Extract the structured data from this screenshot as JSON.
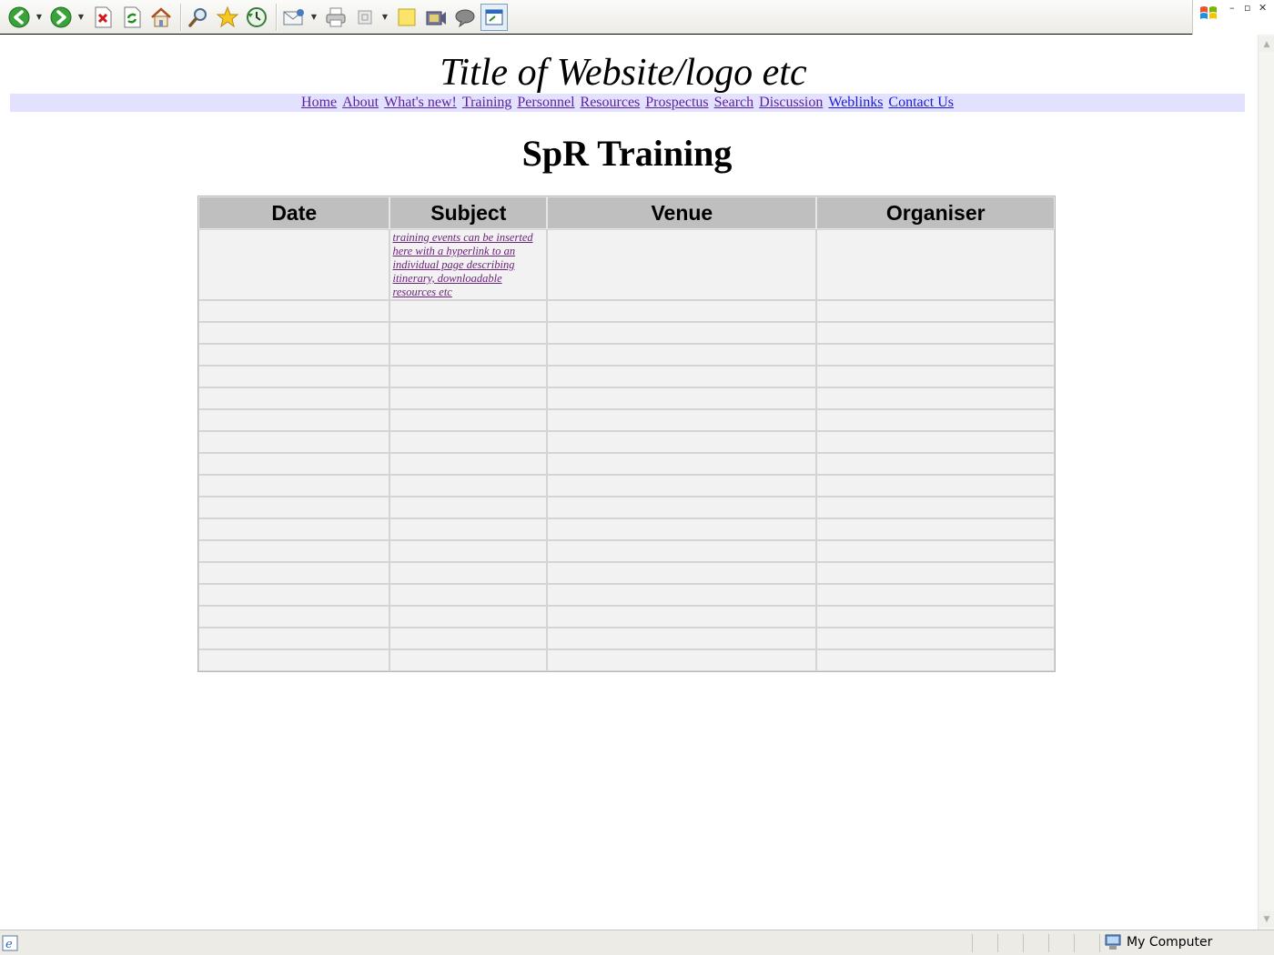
{
  "browser": {
    "toolbar_icons": [
      "back-icon",
      "forward-icon",
      "stop-icon",
      "refresh-icon",
      "home-icon",
      "search-icon",
      "favorites-icon",
      "history-icon",
      "mail-icon",
      "print-icon",
      "edit-icon",
      "notes-icon",
      "media-icon",
      "discuss-icon",
      "active-window-icon"
    ],
    "status_zone": "My Computer"
  },
  "site": {
    "title": "Title of Website/logo etc",
    "nav": [
      {
        "label": "Home",
        "visited": true
      },
      {
        "label": "About",
        "visited": true
      },
      {
        "label": "What's new!",
        "visited": true
      },
      {
        "label": "Training",
        "visited": true
      },
      {
        "label": "Personnel",
        "visited": true
      },
      {
        "label": "Resources",
        "visited": true
      },
      {
        "label": "Prospectus",
        "visited": true
      },
      {
        "label": "Search",
        "visited": true
      },
      {
        "label": "Discussion",
        "visited": true
      },
      {
        "label": "Weblinks",
        "visited": false
      },
      {
        "label": "Contact Us",
        "visited": false
      }
    ]
  },
  "main": {
    "heading": "SpR Training",
    "table": {
      "headers": [
        "Date",
        "Subject",
        "Venue",
        "Organiser"
      ],
      "first_row_subject": "training events can be inserted here with a hyperlink to an individual page describing itinerary, downloadable resources etc"
    }
  },
  "colors": {
    "nav_background": "#e2e2ff",
    "visited_link": "#5b1fa0",
    "link": "#1a1ad8",
    "table_header": "#bfbfbf",
    "table_cell": "#f2f2f2"
  }
}
